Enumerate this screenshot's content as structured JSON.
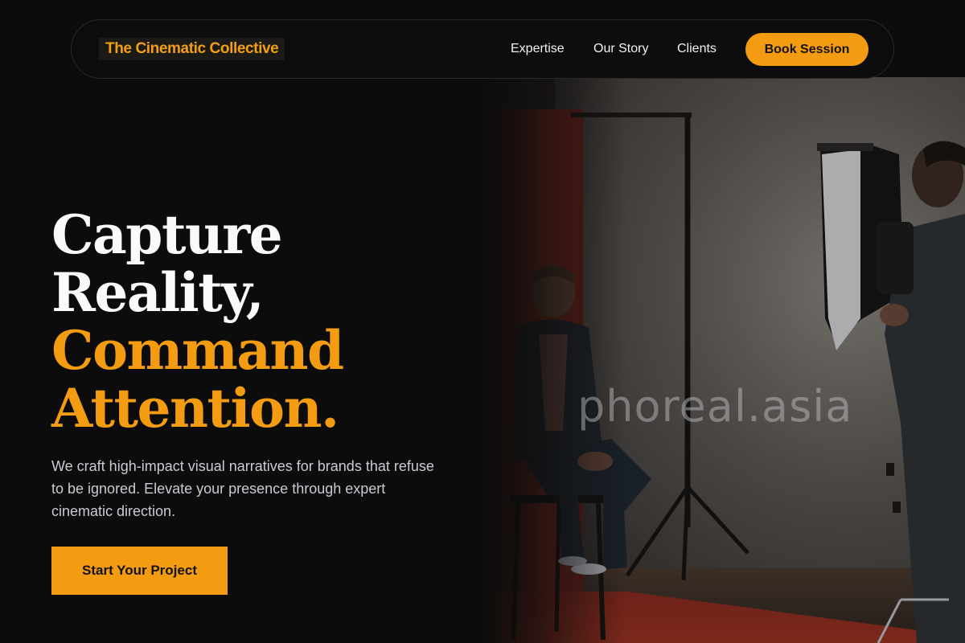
{
  "brand": {
    "name": "The Cinematic Collective",
    "accent": "#f39c12"
  },
  "nav": {
    "links": [
      "Expertise",
      "Our Story",
      "Clients"
    ],
    "cta": "Book Session"
  },
  "hero": {
    "title_lines": [
      "Capture",
      "Reality,",
      "Command",
      "Attention."
    ],
    "description": "We craft high-impact visual narratives for brands that refuse to be ignored. Elevate your presence through expert cinematic direction.",
    "cta": "Start Your Project"
  },
  "image": {
    "watermark": "phoreal.asia"
  },
  "icons": [
    "studio-photo"
  ]
}
